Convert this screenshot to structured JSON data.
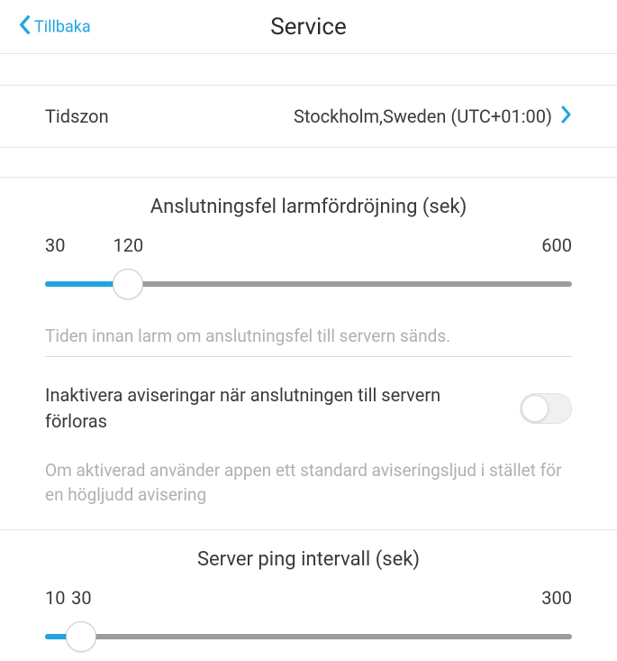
{
  "header": {
    "back_label": "Tillbaka",
    "title": "Service"
  },
  "timezone": {
    "label": "Tidszon",
    "value": "Stockholm,Sweden (UTC+01:00)"
  },
  "conn_delay": {
    "title": "Anslutningsfel larmfördröjning (sek)",
    "min": 30,
    "value": 120,
    "max": 600,
    "percent": 15.79,
    "hint": "Tiden innan larm om anslutningsfel till servern sänds."
  },
  "disable_notif": {
    "label": "Inaktivera aviseringar när anslutningen till servern förloras",
    "enabled": false,
    "description": "Om aktiverad använder appen ett standard aviseringsljud i stället för en högljudd avisering"
  },
  "ping_interval": {
    "title": "Server ping intervall (sek)",
    "min": 10,
    "value": 30,
    "max": 300,
    "percent": 6.9
  }
}
